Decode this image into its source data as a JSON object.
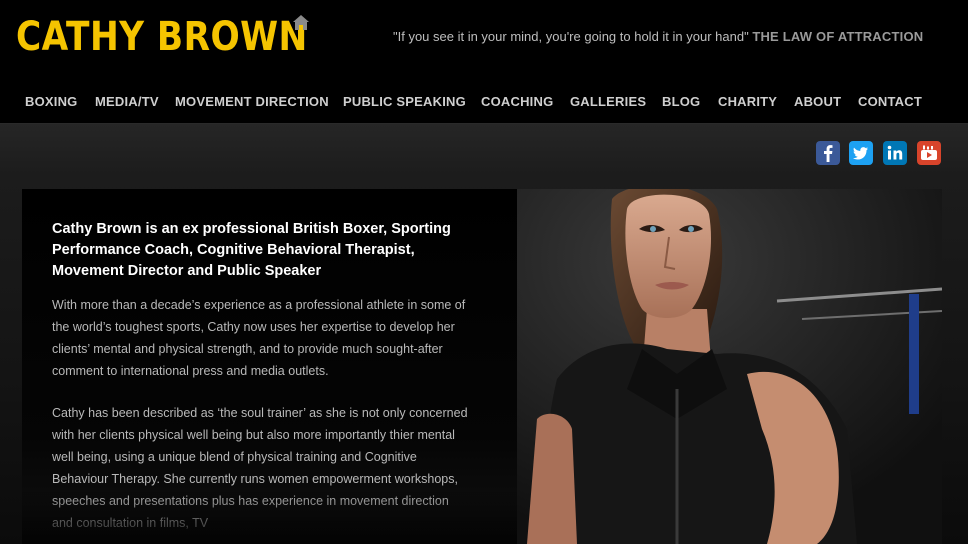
{
  "header": {
    "brand": "CATHY BROWN",
    "home_icon": "home-icon",
    "quote_text": "\"If you see it in your mind, you're going to hold it in your hand\"",
    "quote_title": "THE LAW OF ATTRACTION"
  },
  "nav": {
    "items": [
      {
        "label": "BOXING"
      },
      {
        "label": "MEDIA/TV"
      },
      {
        "label": "MOVEMENT DIRECTION"
      },
      {
        "label": "PUBLIC SPEAKING"
      },
      {
        "label": "COACHING"
      },
      {
        "label": "GALLERIES"
      },
      {
        "label": "BLOG"
      },
      {
        "label": "CHARITY"
      },
      {
        "label": "ABOUT"
      },
      {
        "label": "CONTACT"
      }
    ]
  },
  "social": {
    "icons": [
      {
        "name": "facebook-icon",
        "color": "#3b5998"
      },
      {
        "name": "twitter-icon",
        "color": "#1da1f2"
      },
      {
        "name": "linkedin-icon",
        "color": "#0077b5"
      },
      {
        "name": "youtube-icon",
        "color": "#d8442b"
      }
    ]
  },
  "intro": {
    "headline": "Cathy Brown is an ex professional British Boxer, Sporting Performance Coach, Cognitive Behavioral Therapist, Movement Director and Public Speaker",
    "paragraph1": "With more than a decade’s experience as a professional athlete in some of the world’s toughest sports, Cathy now uses her expertise to develop her clients’ mental and physical strength, and to provide much sought-after comment to international press and media outlets.",
    "paragraph2": "Cathy has been described as ‘the soul trainer’ as she is not only concerned with her clients physical well being but also more importantly thier mental well being, using a unique blend of physical training and Cognitive Behaviour Therapy. She currently runs women empowerment workshops, speeches and presentations plus has experience in movement direction and consultation in films, TV"
  },
  "colors": {
    "brand_yellow": "#f5c400",
    "nav_text": "#cfcfcf",
    "background": "#000000"
  }
}
